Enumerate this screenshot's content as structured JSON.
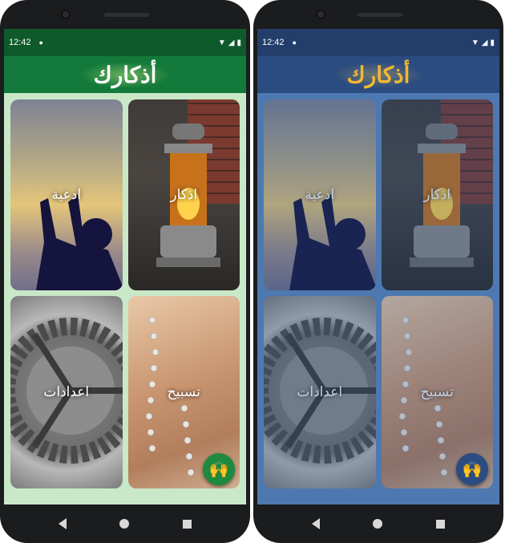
{
  "status_bar": {
    "time": "12:42"
  },
  "app": {
    "title": "أذكارك"
  },
  "cards": {
    "doaa": {
      "label": "ادعية"
    },
    "azkar": {
      "label": "اذكار"
    },
    "settings": {
      "label": "اعدادات"
    },
    "tasbih": {
      "label": "تسبيح"
    }
  },
  "themes": {
    "left": {
      "name": "green",
      "appbar": "#137a3b",
      "status": "#0f5a2b",
      "background": "#c9e8c7",
      "title_color": "#ffffff"
    },
    "right": {
      "name": "blue",
      "appbar": "#2b4c80",
      "status": "#233e6b",
      "background": "#4d79b0",
      "title_color": "#f2b830"
    }
  },
  "icons": {
    "status": [
      "settings-icon",
      "notification-dot-icon",
      "wifi-icon",
      "signal-icon",
      "battery-icon"
    ],
    "fab": "person-praying-icon",
    "nav": [
      "back-icon",
      "home-icon",
      "recents-icon"
    ]
  }
}
